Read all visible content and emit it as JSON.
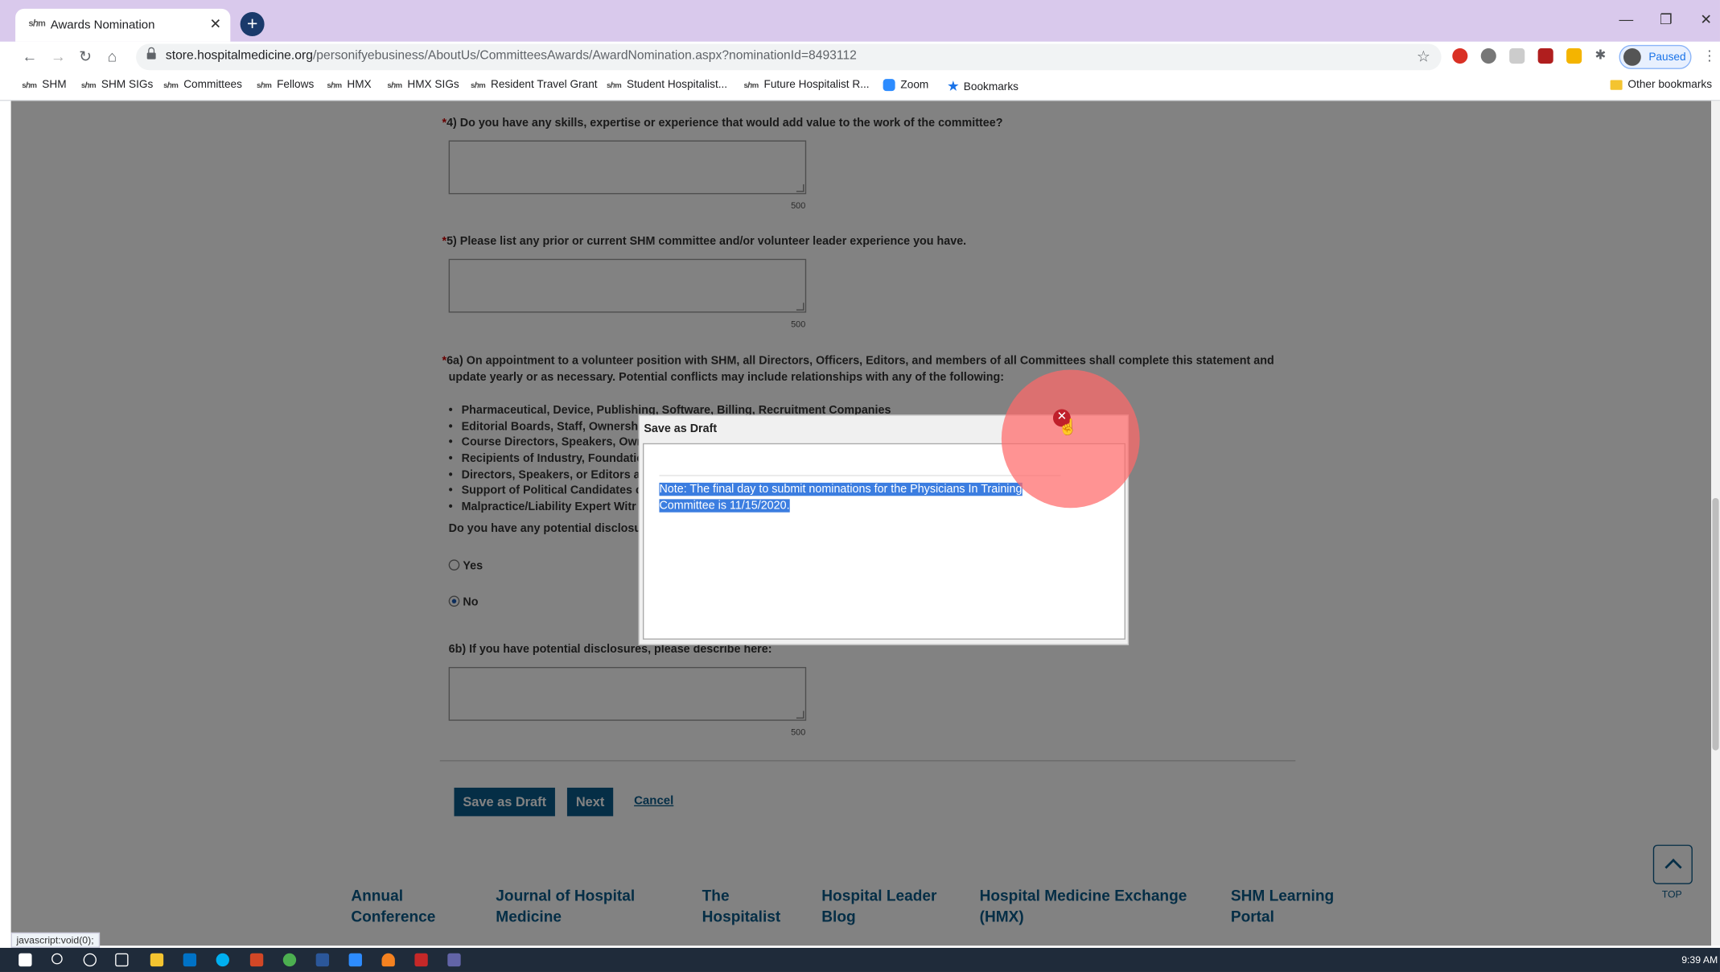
{
  "browser": {
    "tab_favicon": "sℎm",
    "tab_title": "Awards Nomination",
    "tab_close": "✕",
    "url_domain": "store.hospitalmedicine.org",
    "url_path": "/personifyebusiness/AboutUs/CommitteesAwards/AwardNomination.aspx?nominationId=8493112",
    "profile_status": "Paused"
  },
  "bookmarks": [
    {
      "label": "SHM",
      "icon": "shm-icon"
    },
    {
      "label": "SHM SIGs",
      "icon": "shm-icon"
    },
    {
      "label": "Committees",
      "icon": "shm-icon"
    },
    {
      "label": "Fellows",
      "icon": "shm-icon"
    },
    {
      "label": "HMX",
      "icon": "shm-icon"
    },
    {
      "label": "HMX SIGs",
      "icon": "shm-icon"
    },
    {
      "label": "Resident Travel Grant",
      "icon": "shm-icon"
    },
    {
      "label": "Student Hospitalist...",
      "icon": "shm-icon"
    },
    {
      "label": "Future Hospitalist R...",
      "icon": "shm-icon"
    },
    {
      "label": "Zoom",
      "icon": "zoom-icon"
    },
    {
      "label": "Bookmarks",
      "icon": "star-icon"
    },
    {
      "label": "Other bookmarks",
      "icon": "folder-icon"
    }
  ],
  "form": {
    "required_mark": "*",
    "q4": "4) Do you have any skills, expertise or experience that would add value to the work of the committee?",
    "q5": "5) Please list any prior or current SHM committee and/or volunteer leader experience you have.",
    "q6a_line1": "6a) On appointment to a volunteer position with SHM, all Directors, Officers, Editors, and members of all Committees shall complete this statement and",
    "q6a_line2": "update yearly or as necessary. Potential conflicts may include relationships with any of the following:",
    "bullets": [
      "Pharmaceutical, Device, Publishing, Software, Billing, Recruitment Companies",
      "Editorial Boards, Staff, Ownership",
      "Course Directors, Speakers, Own",
      "Recipients of Industry, Foundatic",
      "Directors, Speakers, or Editors at",
      "Support of Political Candidates c",
      "Malpractice/Liability Expert Witr"
    ],
    "disclosure_question": "Do you have any potential disclosur",
    "option_yes": "Yes",
    "option_no": "No",
    "selected_option": "No",
    "q6b": "6b) If you have potential disclosures, please describe here:",
    "char_limit": "500",
    "save_draft_button": "Save as Draft",
    "next_button": "Next",
    "cancel_link": "Cancel"
  },
  "footer": {
    "links": [
      [
        "Annual",
        "Conference"
      ],
      [
        "Journal of Hospital",
        "Medicine"
      ],
      [
        "The",
        "Hospitalist"
      ],
      [
        "Hospital Leader",
        "Blog"
      ],
      [
        "Hospital Medicine Exchange",
        "(HMX)"
      ],
      [
        "SHM Learning",
        "Portal"
      ]
    ],
    "top_label": "TOP"
  },
  "modal": {
    "title": "Save as Draft",
    "close_icon": "✕",
    "note_line1": "Note: The final day to submit nominations for the Physicians In Training",
    "note_line2": "Committee is 11/15/2020."
  },
  "status_bar": "javascript:void(0);",
  "taskbar": {
    "time": "9:39 AM"
  }
}
